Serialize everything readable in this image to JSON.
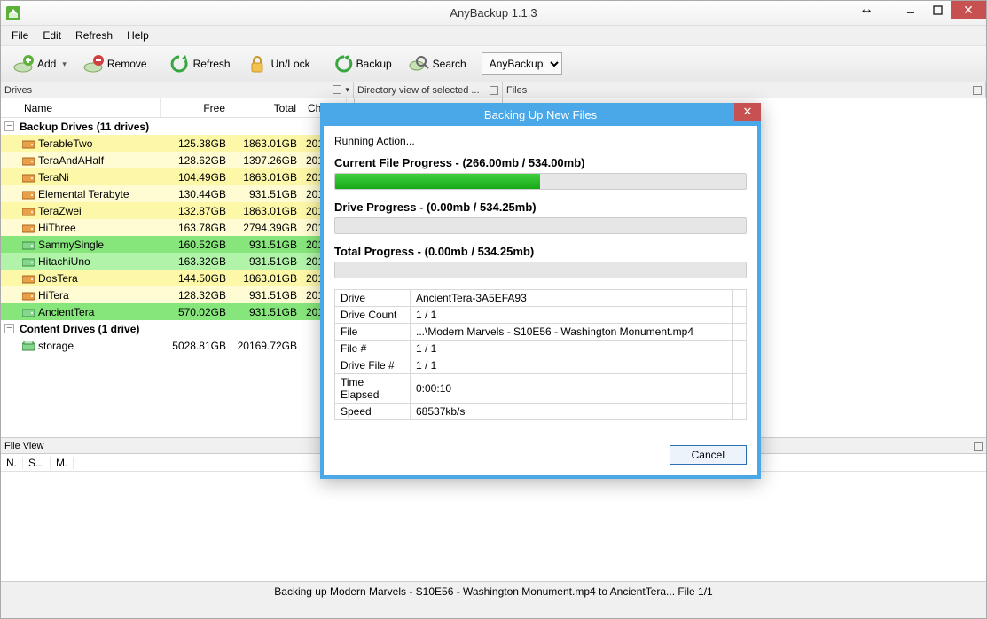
{
  "title": "AnyBackup 1.1.3",
  "menu": {
    "file": "File",
    "edit": "Edit",
    "refresh": "Refresh",
    "help": "Help"
  },
  "toolbar": {
    "add": "Add",
    "remove": "Remove",
    "refresh": "Refresh",
    "unlock": "Un/Lock",
    "backup": "Backup",
    "search": "Search",
    "select": "AnyBackup"
  },
  "panes": {
    "drives": "Drives",
    "dirview": "Directory view of selected ...",
    "files": "Files"
  },
  "columns": {
    "name": "Name",
    "free": "Free",
    "total": "Total",
    "chk": "Chk"
  },
  "group1": "Backup Drives (11 drives)",
  "group2": "Content Drives (1 drive)",
  "drives": [
    {
      "name": "TerableTwo",
      "free": "125.38GB",
      "total": "1863.01GB",
      "chk": "2014",
      "cls": "row-yellow",
      "icon": "b"
    },
    {
      "name": "TeraAndAHalf",
      "free": "128.62GB",
      "total": "1397.26GB",
      "chk": "2014",
      "cls": "row-yellow2",
      "icon": "b"
    },
    {
      "name": "TeraNi",
      "free": "104.49GB",
      "total": "1863.01GB",
      "chk": "2014",
      "cls": "row-yellow",
      "icon": "b"
    },
    {
      "name": "Elemental Terabyte",
      "free": "130.44GB",
      "total": "931.51GB",
      "chk": "2014",
      "cls": "row-yellow2",
      "icon": "b"
    },
    {
      "name": "TeraZwei",
      "free": "132.87GB",
      "total": "1863.01GB",
      "chk": "2014",
      "cls": "row-yellow",
      "icon": "b"
    },
    {
      "name": "HiThree",
      "free": "163.78GB",
      "total": "2794.39GB",
      "chk": "2014",
      "cls": "row-yellow2",
      "icon": "b"
    },
    {
      "name": "SammySingle",
      "free": "160.52GB",
      "total": "931.51GB",
      "chk": "2014",
      "cls": "row-green",
      "icon": "g"
    },
    {
      "name": "HitachiUno",
      "free": "163.32GB",
      "total": "931.51GB",
      "chk": "2014",
      "cls": "row-green2",
      "icon": "g"
    },
    {
      "name": "DosTera",
      "free": "144.50GB",
      "total": "1863.01GB",
      "chk": "2014",
      "cls": "row-yellow",
      "icon": "b"
    },
    {
      "name": "HiTera",
      "free": "128.32GB",
      "total": "931.51GB",
      "chk": "2014",
      "cls": "row-yellow2",
      "icon": "b"
    },
    {
      "name": "AncientTera",
      "free": "570.02GB",
      "total": "931.51GB",
      "chk": "2014",
      "cls": "row-green",
      "icon": "g"
    }
  ],
  "content_drive": {
    "name": "storage",
    "free": "5028.81GB",
    "total": "20169.72GB"
  },
  "fileview": {
    "title": "File View",
    "c1": "N.",
    "c2": "S...",
    "c3": "M."
  },
  "status": "Backing up Modern Marvels - S10E56 - Washington Monument.mp4 to AncientTera... File 1/1",
  "dialog": {
    "title": "Backing Up New Files",
    "running": "Running Action...",
    "cfp_label": "Current File Progress - (266.00mb / 534.00mb)",
    "cfp_pct": 49.8,
    "dp_label": "Drive Progress - (0.00mb / 534.25mb)",
    "dp_pct": 0,
    "tp_label": "Total Progress - (0.00mb / 534.25mb)",
    "tp_pct": 0,
    "rows": {
      "drive_k": "Drive",
      "drive_v": "AncientTera-3A5EFA93",
      "dcount_k": "Drive Count",
      "dcount_v": "1 / 1",
      "file_k": "File",
      "file_v": "...\\Modern Marvels - S10E56 - Washington Monument.mp4",
      "fnum_k": "File #",
      "fnum_v": "1 / 1",
      "dfnum_k": "Drive File #",
      "dfnum_v": "1 / 1",
      "time_k": "Time Elapsed",
      "time_v": "0:00:10",
      "speed_k": "Speed",
      "speed_v": "68537kb/s"
    },
    "cancel": "Cancel"
  }
}
